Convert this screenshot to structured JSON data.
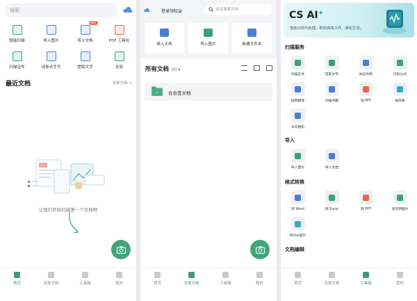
{
  "panel1": {
    "search_placeholder": "搜索",
    "tools": [
      {
        "label": "智能扫描",
        "icon": "scan-icon",
        "color": "#3aa27a"
      },
      {
        "label": "导入图片",
        "icon": "image-icon",
        "color": "#4a7fd0"
      },
      {
        "label": "导入文档",
        "icon": "document-icon",
        "color": "#4a7fd0",
        "badge": "HOT"
      },
      {
        "label": "PDF 工具包",
        "icon": "pdf-icon",
        "color": "#e8644a"
      },
      {
        "label": "扫描证件",
        "icon": "id-card-icon",
        "color": "#3aa27a"
      },
      {
        "label": "试卷去手写",
        "icon": "eraser-icon",
        "color": "#4a7fd0"
      },
      {
        "label": "提取文字",
        "icon": "text-extract-icon",
        "color": "#4a7fd0"
      },
      {
        "label": "全部",
        "icon": "grid-icon",
        "color": "#3aa27a"
      }
    ],
    "recent_title": "最近文档",
    "recent_more": "全部文档 >",
    "empty_prompt": "让我们开始扫描第一个文档吧",
    "tabs": [
      {
        "label": "首页",
        "icon": "home-icon",
        "active": true
      },
      {
        "label": "全部文档",
        "icon": "docs-icon",
        "active": false
      },
      {
        "label": "工具箱",
        "icon": "toolbox-icon",
        "active": false
      },
      {
        "label": "我的",
        "icon": "user-icon",
        "active": false
      }
    ]
  },
  "panel2": {
    "login_text": "登录领权益",
    "search_placeholder": "试试搜索文档",
    "cards": [
      {
        "label": "导入文档",
        "icon": "import-doc-icon"
      },
      {
        "label": "导入图片",
        "icon": "import-image-icon"
      },
      {
        "label": "新建文件夹",
        "icon": "new-folder-icon"
      }
    ],
    "all_docs_title": "所有文档",
    "all_docs_count": "(0) ▾",
    "folder_name": "合合签文档",
    "tabs": [
      {
        "label": "首页",
        "icon": "home-icon",
        "active": false
      },
      {
        "label": "全部文档",
        "icon": "docs-icon",
        "active": true
      },
      {
        "label": "工具箱",
        "icon": "toolbox-icon",
        "active": false
      },
      {
        "label": "我的",
        "icon": "user-icon",
        "active": false
      }
    ]
  },
  "panel3": {
    "banner_title": "CS AI",
    "banner_sub": "智能识别与处理，助你高效工作、简化生活。",
    "sections": [
      {
        "title": "扫描服务",
        "items": [
          {
            "label": "扫描证件",
            "icon": "id-scan-icon",
            "color": "#3aa27a"
          },
          {
            "label": "提取文字",
            "icon": "text-icon",
            "color": "#3aa27a"
          },
          {
            "label": "拍证件照",
            "icon": "photo-id-icon",
            "color": "#4a7fd0"
          },
          {
            "label": "识别公式",
            "icon": "formula-icon",
            "color": "#3aa27a"
          },
          {
            "label": "拍照翻译",
            "icon": "translate-icon",
            "color": "#4a7fd0"
          },
          {
            "label": "扫描书籍",
            "icon": "book-icon",
            "color": "#4a7fd0"
          },
          {
            "label": "拍 PPT",
            "icon": "ppt-icon",
            "color": "#e8644a"
          },
          {
            "label": "拍白板",
            "icon": "whiteboard-icon",
            "color": "#38a8c8"
          },
          {
            "label": "水印相机",
            "icon": "watermark-camera-icon",
            "color": "#4a7fd0"
          }
        ]
      },
      {
        "title": "导入",
        "items": [
          {
            "label": "导入图片",
            "icon": "import-image-icon",
            "color": "#3aa27a"
          },
          {
            "label": "导入文档",
            "icon": "import-doc-icon",
            "color": "#4a7fd0"
          }
        ]
      },
      {
        "title": "格式转换",
        "items": [
          {
            "label": "转 Word",
            "icon": "word-icon",
            "color": "#4a7fd0"
          },
          {
            "label": "转 Excel",
            "icon": "excel-icon",
            "color": "#3aa27a"
          },
          {
            "label": "转 PPT",
            "icon": "ppt-convert-icon",
            "color": "#e8644a"
          },
          {
            "label": "退页转图片",
            "icon": "page-image-icon",
            "color": "#3aa27a"
          },
          {
            "label": "转为长图片",
            "icon": "long-image-icon",
            "color": "#38a8c8"
          }
        ]
      },
      {
        "title": "文档编辑",
        "items": []
      }
    ],
    "tabs": [
      {
        "label": "首页",
        "icon": "home-icon",
        "active": false
      },
      {
        "label": "全部文档",
        "icon": "docs-icon",
        "active": false
      },
      {
        "label": "工具箱",
        "icon": "toolbox-icon",
        "active": true
      },
      {
        "label": "我的",
        "icon": "user-icon",
        "active": false
      }
    ]
  },
  "colors": {
    "accent": "#3d9c72",
    "fab": "#43a47c"
  }
}
